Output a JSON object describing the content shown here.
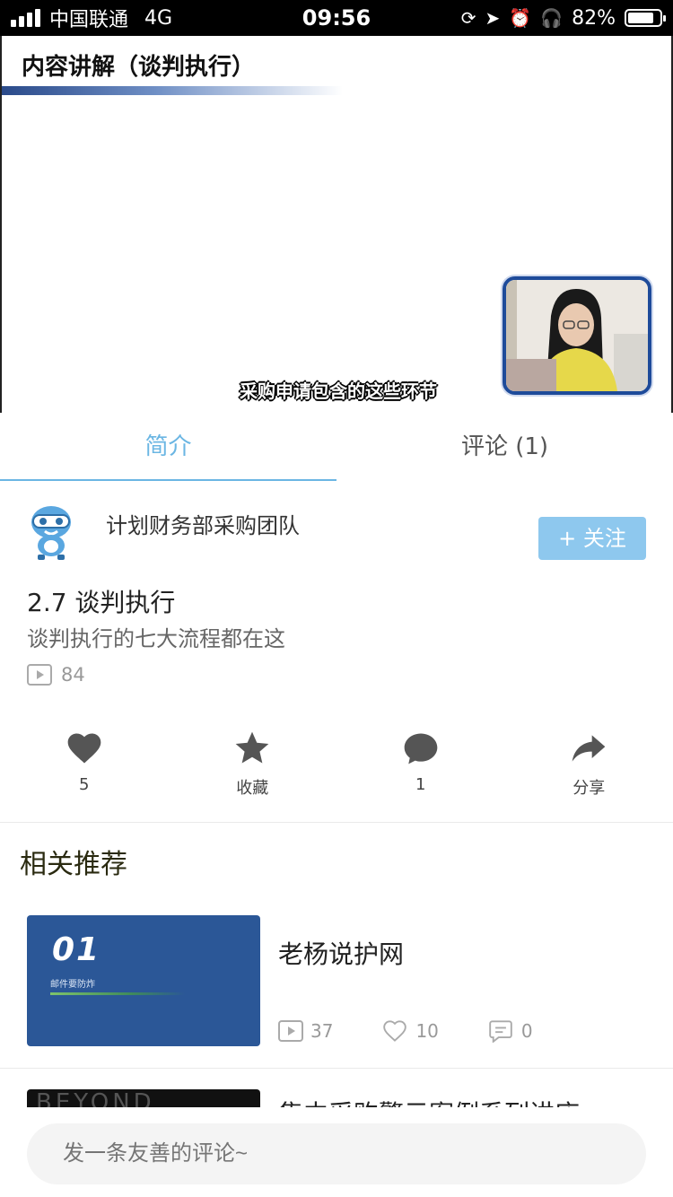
{
  "status_bar": {
    "carrier": "中国联通",
    "network": "4G",
    "time": "09:56",
    "battery": "82%",
    "battery_level": 0.82
  },
  "video": {
    "slide_title": "内容讲解（谈判执行）",
    "subtitle": "采购申请包含的这些环节"
  },
  "tabs": [
    {
      "label": "简介",
      "active": true
    },
    {
      "label": "评论 (1)",
      "active": false
    }
  ],
  "author": {
    "name": "计划财务部采购团队",
    "follow_label": "+ 关注"
  },
  "detail": {
    "title": "2.7 谈判执行",
    "description": "谈判执行的七大流程都在这",
    "play_count": "84"
  },
  "actions": [
    {
      "icon": "heart-icon",
      "label": "5"
    },
    {
      "icon": "star-icon",
      "label": "收藏"
    },
    {
      "icon": "comment-icon",
      "label": "1"
    },
    {
      "icon": "share-icon",
      "label": "分享"
    }
  ],
  "recommendations": {
    "heading": "相关推荐",
    "items": [
      {
        "title": "老杨说护网",
        "thumb_number": "01",
        "thumb_caption": "邮件要防炸",
        "plays": "37",
        "likes": "10",
        "comments": "0"
      },
      {
        "title": "集中采购警示案例系列讲座",
        "thumb_text": "BEYOND"
      }
    ]
  },
  "comment": {
    "placeholder": "发一条友善的评论~"
  },
  "colors": {
    "accent": "#6bb6e3",
    "follow_button": "#8ec8ee",
    "icon_gray": "#555555",
    "thumb_blue": "#2b5797"
  }
}
